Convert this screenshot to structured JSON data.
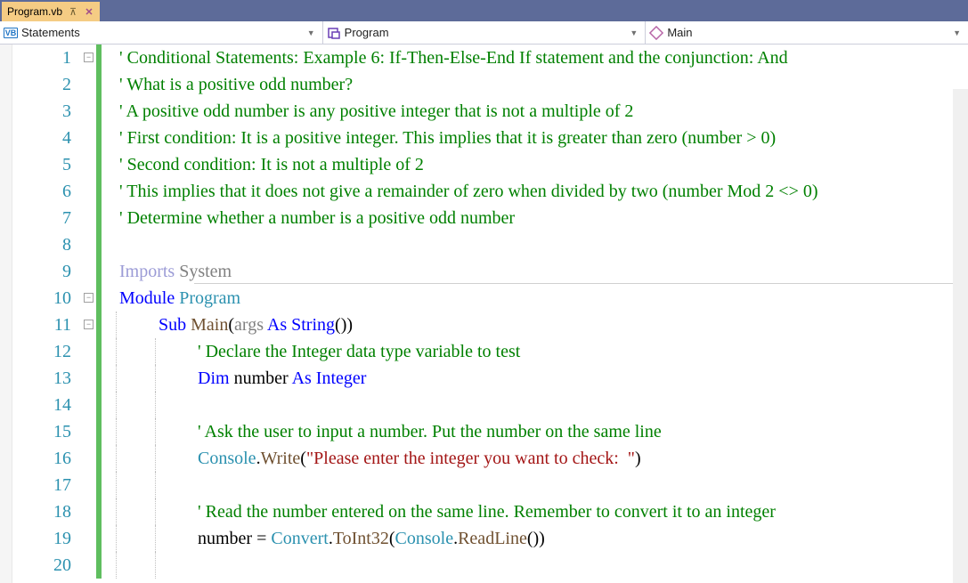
{
  "tab": {
    "label": "Program.vb"
  },
  "nav": {
    "scope": {
      "icon": "VB",
      "text": "Statements"
    },
    "type": {
      "text": "Program"
    },
    "member": {
      "text": "Main"
    }
  },
  "lines": [
    {
      "n": 1,
      "bar": true,
      "fold": "-",
      "tokens": [
        [
          "c-comment",
          "' Conditional Statements: Example 6: If-Then-Else-End If statement and the conjunction: And"
        ]
      ]
    },
    {
      "n": 2,
      "bar": true,
      "tokens": [
        [
          "c-comment",
          "' What is a positive odd number?"
        ]
      ]
    },
    {
      "n": 3,
      "bar": true,
      "tokens": [
        [
          "c-comment",
          "' A positive odd number is any positive integer that is not a multiple of 2"
        ]
      ]
    },
    {
      "n": 4,
      "bar": true,
      "tokens": [
        [
          "c-comment",
          "' First condition: It is a positive integer. This implies that it is greater than zero (number > 0)"
        ]
      ]
    },
    {
      "n": 5,
      "bar": true,
      "tokens": [
        [
          "c-comment",
          "' Second condition: It is not a multiple of 2"
        ]
      ]
    },
    {
      "n": 6,
      "bar": true,
      "tokens": [
        [
          "c-comment",
          "' This implies that it does not give a remainder of zero when divided by two (number Mod 2 <> 0)"
        ]
      ]
    },
    {
      "n": 7,
      "bar": true,
      "tokens": [
        [
          "c-comment",
          "' Determine whether a number is a positive odd number"
        ]
      ]
    },
    {
      "n": 8,
      "bar": true,
      "tokens": [
        [
          "c-text",
          ""
        ]
      ]
    },
    {
      "n": 9,
      "bar": true,
      "sep": true,
      "tokens": [
        [
          "c-import",
          "Imports "
        ],
        [
          "c-gray",
          "System"
        ]
      ]
    },
    {
      "n": 10,
      "bar": true,
      "fold": "-",
      "tokens": [
        [
          "c-key",
          "Module "
        ],
        [
          "c-type",
          "Program"
        ]
      ]
    },
    {
      "n": 11,
      "bar": true,
      "fold": "-",
      "indent": 1,
      "tokens": [
        [
          "c-key",
          "Sub "
        ],
        [
          "c-func",
          "Main"
        ],
        [
          "c-text",
          "("
        ],
        [
          "c-gray",
          "args"
        ],
        [
          "c-text",
          " "
        ],
        [
          "c-key",
          "As"
        ],
        [
          "c-text",
          " "
        ],
        [
          "c-key",
          "String"
        ],
        [
          "c-text",
          "())"
        ]
      ]
    },
    {
      "n": 12,
      "bar": true,
      "indent": 2,
      "tokens": [
        [
          "c-comment",
          "' Declare the Integer data type variable to test"
        ]
      ]
    },
    {
      "n": 13,
      "bar": true,
      "indent": 2,
      "tokens": [
        [
          "c-key",
          "Dim "
        ],
        [
          "c-text",
          "number "
        ],
        [
          "c-key",
          "As Integer"
        ]
      ]
    },
    {
      "n": 14,
      "bar": true,
      "indent": 2,
      "tokens": [
        [
          "c-text",
          ""
        ]
      ]
    },
    {
      "n": 15,
      "bar": true,
      "indent": 2,
      "tokens": [
        [
          "c-comment",
          "' Ask the user to input a number. Put the number on the same line"
        ]
      ]
    },
    {
      "n": 16,
      "bar": true,
      "indent": 2,
      "tokens": [
        [
          "c-type",
          "Console"
        ],
        [
          "c-text",
          "."
        ],
        [
          "c-func",
          "Write"
        ],
        [
          "c-text",
          "("
        ],
        [
          "c-str",
          "\"Please enter the integer you want to check:  \""
        ],
        [
          "c-text",
          ")"
        ]
      ]
    },
    {
      "n": 17,
      "bar": true,
      "indent": 2,
      "tokens": [
        [
          "c-text",
          ""
        ]
      ]
    },
    {
      "n": 18,
      "bar": true,
      "indent": 2,
      "tokens": [
        [
          "c-comment",
          "' Read the number entered on the same line. Remember to convert it to an integer"
        ]
      ]
    },
    {
      "n": 19,
      "bar": true,
      "indent": 2,
      "tokens": [
        [
          "c-text",
          "number = "
        ],
        [
          "c-type",
          "Convert"
        ],
        [
          "c-text",
          "."
        ],
        [
          "c-func",
          "ToInt32"
        ],
        [
          "c-text",
          "("
        ],
        [
          "c-type",
          "Console"
        ],
        [
          "c-text",
          "."
        ],
        [
          "c-func",
          "ReadLine"
        ],
        [
          "c-text",
          "())"
        ]
      ]
    },
    {
      "n": 20,
      "bar": true,
      "indent": 2,
      "tokens": [
        [
          "c-text",
          ""
        ]
      ]
    }
  ]
}
